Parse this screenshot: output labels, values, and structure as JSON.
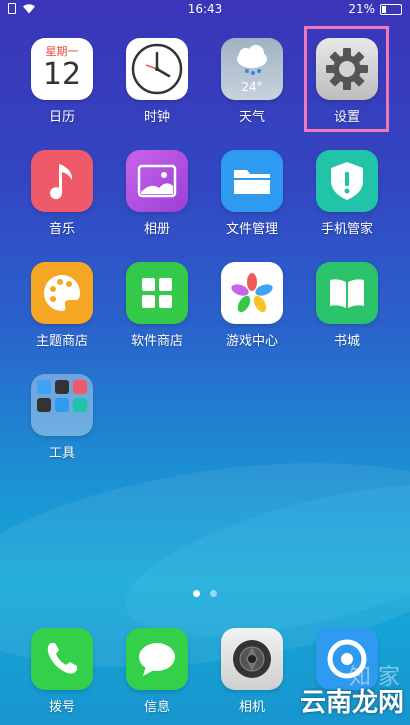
{
  "status": {
    "time": "16:43",
    "battery": "21%",
    "battery_level": 0.21
  },
  "apps": [
    {
      "id": "calendar",
      "label": "日历",
      "weekday": "星期一",
      "day": "12"
    },
    {
      "id": "clock",
      "label": "时钟"
    },
    {
      "id": "weather",
      "label": "天气",
      "temp": "24°"
    },
    {
      "id": "settings",
      "label": "设置"
    },
    {
      "id": "music",
      "label": "音乐"
    },
    {
      "id": "album",
      "label": "相册"
    },
    {
      "id": "files",
      "label": "文件管理"
    },
    {
      "id": "phone-manager",
      "label": "手机管家"
    },
    {
      "id": "theme-store",
      "label": "主题商店"
    },
    {
      "id": "app-store",
      "label": "软件商店"
    },
    {
      "id": "game-center",
      "label": "游戏中心"
    },
    {
      "id": "books",
      "label": "书城"
    },
    {
      "id": "tools",
      "label": "工具"
    }
  ],
  "dock": [
    {
      "id": "dialer",
      "label": "拨号"
    },
    {
      "id": "messages",
      "label": "信息"
    },
    {
      "id": "camera",
      "label": "相机"
    },
    {
      "id": "browser",
      "label": ""
    }
  ],
  "page_indicator": {
    "current": 1,
    "total": 2
  },
  "watermark": {
    "main": "云南龙网",
    "faint": "知 家"
  },
  "colors": {
    "highlight": "#f078b8"
  }
}
